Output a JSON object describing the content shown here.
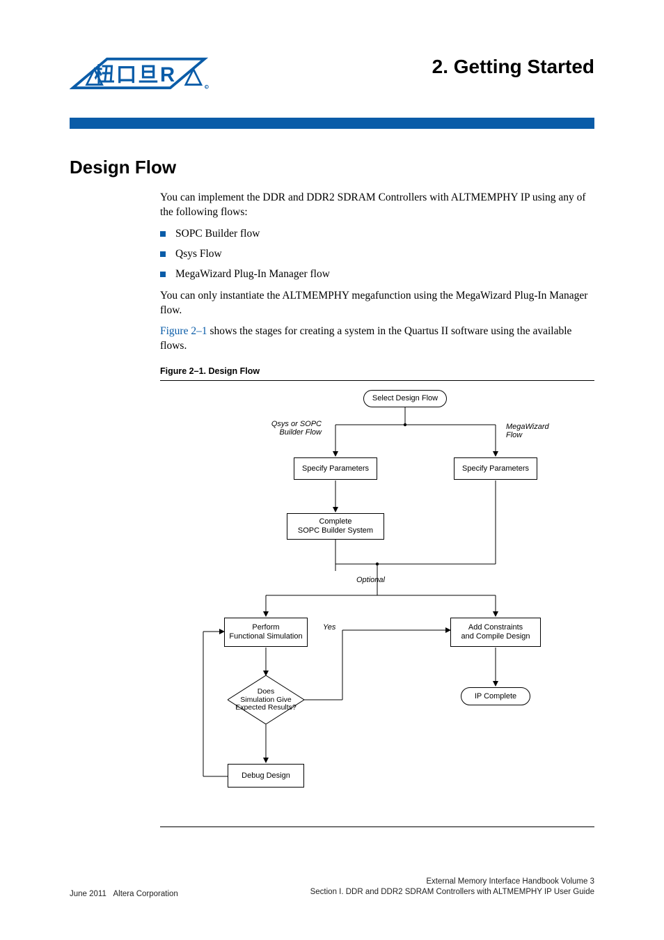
{
  "header": {
    "chapter_title": "2.  Getting Started"
  },
  "sections": {
    "design_flow": {
      "title": "Design Flow",
      "intro": "You can implement the DDR and DDR2 SDRAM Controllers with ALTMEMPHY IP using any of the following flows:",
      "bullets": [
        "SOPC Builder flow",
        "Qsys Flow",
        "MegaWizard Plug-In Manager flow"
      ],
      "para2": "You can only instantiate the ALTMEMPHY megafunction using the MegaWizard Plug-In Manager flow.",
      "para3_pre": "Figure 2–1",
      "para3_post": " shows the stages for creating a system in the Quartus II software using the available flows."
    }
  },
  "figure": {
    "caption": "Figure 2–1.  Design Flow",
    "nodes": {
      "select": "Select Design Flow",
      "spec_left": "Specify Parameters",
      "spec_right": "Specify Parameters",
      "complete_sopc": "Complete\nSOPC Builder System",
      "perform_sim": "Perform\nFunctional Simulation",
      "add_constraints": "Add Constraints\nand Compile Design",
      "decision": "Does\nSimulation Give\nExpected Results?",
      "ip_complete": "IP Complete",
      "debug": "Debug Design"
    },
    "edge_labels": {
      "qsys_sopc": "Qsys or\nSOPC Builder\nFlow",
      "mega": "MegaWizard\nFlow",
      "optional": "Optional",
      "yes": "Yes"
    }
  },
  "footer": {
    "left_date": "June 2011",
    "left_corp": "Altera Corporation",
    "right_line1": "External Memory Interface Handbook Volume 3",
    "right_line2": "Section I. DDR and DDR2 SDRAM Controllers with ALTMEMPHY IP User Guide"
  }
}
